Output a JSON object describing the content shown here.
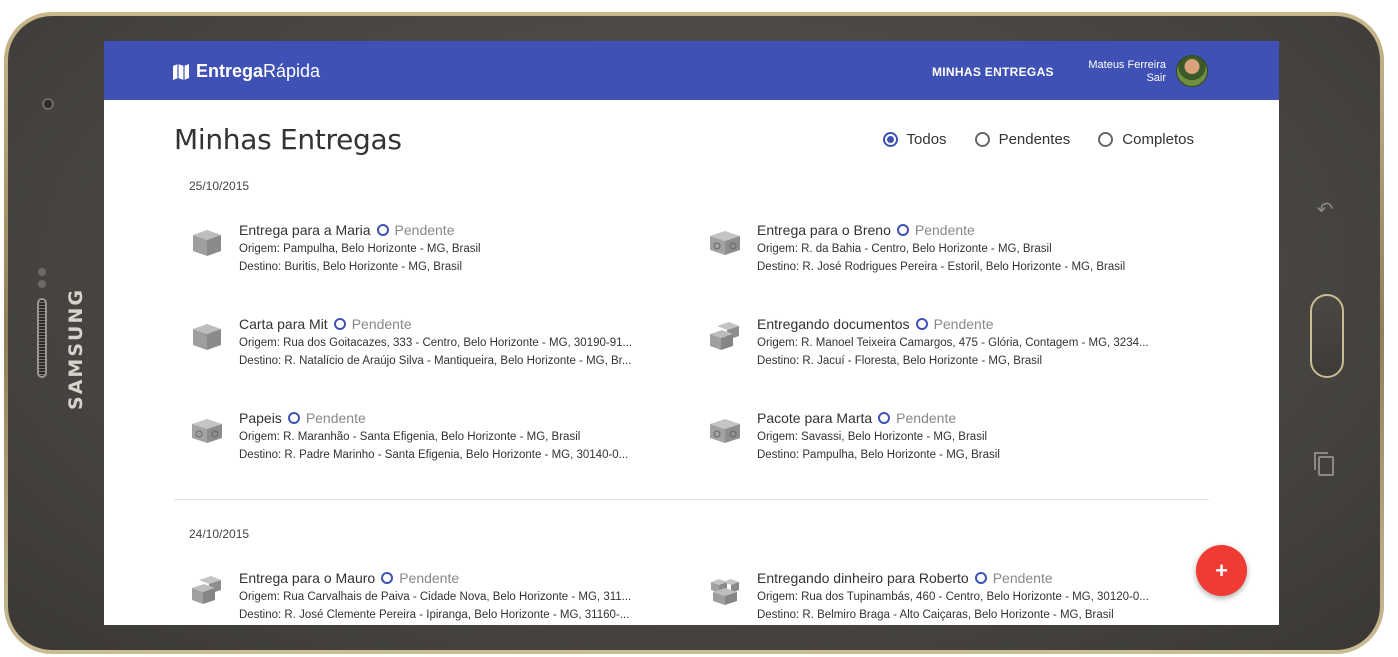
{
  "device": {
    "brand": "SAMSUNG"
  },
  "appbar": {
    "logo_bold": "Entrega",
    "logo_light": "Rápida",
    "nav_link": "MINHAS ENTREGAS",
    "user_name": "Mateus Ferreira",
    "logout": "Sair"
  },
  "page": {
    "title": "Minhas Entregas"
  },
  "filters": [
    {
      "label": "Todos",
      "checked": true
    },
    {
      "label": "Pendentes",
      "checked": false
    },
    {
      "label": "Completos",
      "checked": false
    }
  ],
  "groups": [
    {
      "date": "25/10/2015",
      "items": [
        {
          "title": "Entrega para a Maria",
          "status": "Pendente",
          "origin": "Origem: Pampulha, Belo Horizonte - MG, Brasil",
          "destination": "Destino: Buritis, Belo Horizonte - MG, Brasil",
          "icon": "package-box-icon"
        },
        {
          "title": "Entrega para o Breno",
          "status": "Pendente",
          "origin": "Origem: R. da Bahia - Centro, Belo Horizonte - MG, Brasil",
          "destination": "Destino: R. José Rodrigues Pereira - Estoril, Belo Horizonte - MG, Brasil",
          "icon": "recycle-box-icon"
        },
        {
          "title": "Carta para Mit",
          "status": "Pendente",
          "origin": "Origem: Rua dos Goitacazes, 333 - Centro, Belo Horizonte - MG, 30190-91...",
          "destination": "Destino: R. Natalício de Araújo Silva - Mantiqueira, Belo Horizonte - MG, Br...",
          "icon": "package-box-icon"
        },
        {
          "title": "Entregando documentos",
          "status": "Pendente",
          "origin": "Origem: R. Manoel Teixeira Camargos, 475 - Glória, Contagem - MG, 3234...",
          "destination": "Destino: R. Jacuí - Floresta, Belo Horizonte - MG, Brasil",
          "icon": "stacked-boxes-icon"
        },
        {
          "title": "Papeis",
          "status": "Pendente",
          "origin": "Origem: R. Maranhão - Santa Efigenia, Belo Horizonte - MG, Brasil",
          "destination": "Destino: R. Padre Marinho - Santa Efigenia, Belo Horizonte - MG, 30140-0...",
          "icon": "recycle-box-icon"
        },
        {
          "title": "Pacote para Marta",
          "status": "Pendente",
          "origin": "Origem: Savassi, Belo Horizonte - MG, Brasil",
          "destination": "Destino: Pampulha, Belo Horizonte - MG, Brasil",
          "icon": "recycle-box-icon"
        }
      ]
    },
    {
      "date": "24/10/2015",
      "items": [
        {
          "title": "Entrega para o Mauro",
          "status": "Pendente",
          "origin": "Origem: Rua Carvalhais de Paiva - Cidade Nova, Belo Horizonte - MG, 311...",
          "destination": "Destino: R. José Clemente Pereira - Ipiranga, Belo Horizonte - MG, 31160-...",
          "icon": "stacked-boxes-icon"
        },
        {
          "title": "Entregando dinheiro para Roberto",
          "status": "Pendente",
          "origin": "Origem: Rua dos Tupinambás, 460 - Centro, Belo Horizonte - MG, 30120-0...",
          "destination": "Destino: R. Belmiro Braga - Alto Caiçaras, Belo Horizonte - MG, Brasil",
          "icon": "multi-box-icon"
        }
      ]
    }
  ],
  "fab": {
    "label": "+"
  },
  "colors": {
    "primary": "#3f51b5",
    "fab": "#ef3b34"
  }
}
